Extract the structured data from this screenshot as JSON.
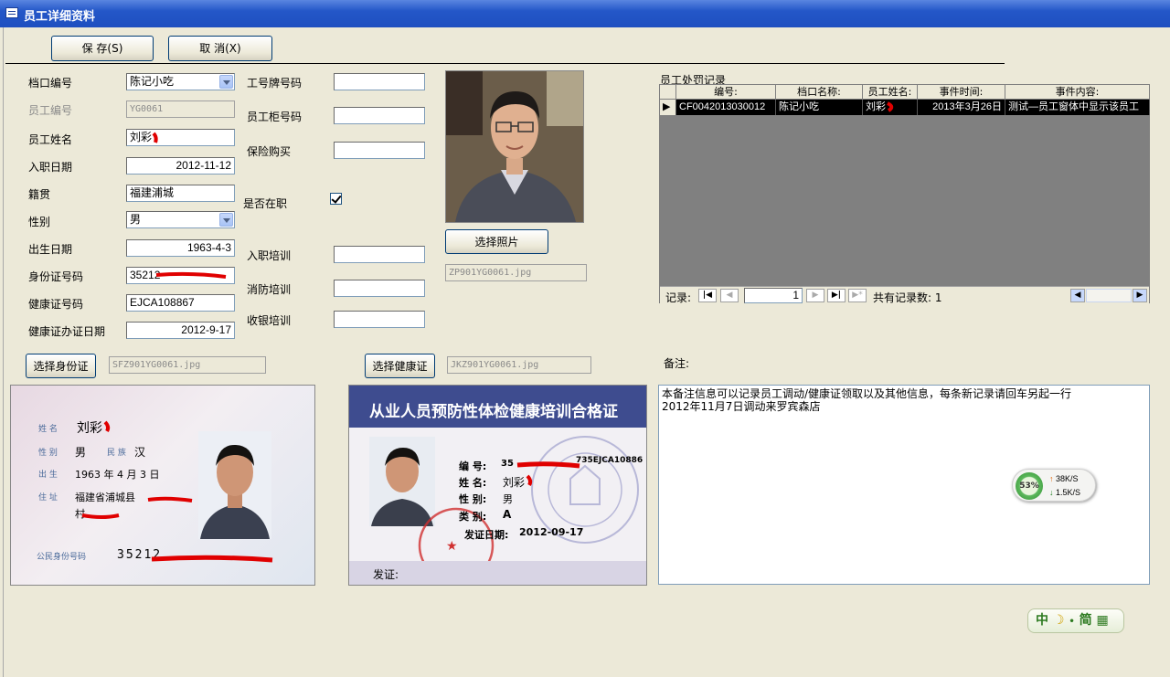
{
  "window": {
    "title": "员工详细资料"
  },
  "toolbar": {
    "save_label": "保 存(S)",
    "cancel_label": "取 消(X)"
  },
  "fields": {
    "stall_no": {
      "label": "档口编号",
      "value": "陈记小吃"
    },
    "emp_no": {
      "label": "员工编号",
      "value": "YG0061"
    },
    "emp_name": {
      "label": "员工姓名",
      "value": "刘彩"
    },
    "hire_date": {
      "label": "入职日期",
      "value": "2012-11-12"
    },
    "native": {
      "label": "籍贯",
      "value": "福建浦城"
    },
    "gender": {
      "label": "性别",
      "value": "男"
    },
    "birth": {
      "label": "出生日期",
      "value": "1963-4-3"
    },
    "id_no": {
      "label": "身份证号码",
      "value": "35212"
    },
    "health_no": {
      "label": "健康证号码",
      "value": "EJCA108867"
    },
    "health_date": {
      "label": "健康证办证日期",
      "value": "2012-9-17"
    },
    "badge_no": {
      "label": "工号牌号码",
      "value": ""
    },
    "locker_no": {
      "label": "员工柜号码",
      "value": ""
    },
    "insurance": {
      "label": "保险购买",
      "value": ""
    },
    "employed": {
      "label": "是否在职",
      "checked": true
    },
    "hire_training": {
      "label": "入职培训",
      "value": ""
    },
    "fire_training": {
      "label": "消防培训",
      "value": ""
    },
    "cashier_training": {
      "label": "收银培训",
      "value": ""
    }
  },
  "photo": {
    "button_label": "选择照片",
    "file": "ZP901YG0061.jpg"
  },
  "id_card": {
    "button_label": "选择身份证",
    "file": "SFZ901YG0061.jpg",
    "image_text": {
      "name_k": "姓 名",
      "name_v": "刘彩",
      "sex_k": "性 别",
      "sex_v": "男",
      "nation_k": "民 族",
      "nation_v": "汉",
      "birth_k": "出 生",
      "birth_v": "1963 年 4 月 3 日",
      "addr_k": "住 址",
      "addr_v": "福建省浦城县",
      "addr_v2": "村",
      "idnum_k": "公民身份号码",
      "idnum_v": "35212"
    }
  },
  "health_card": {
    "button_label": "选择健康证",
    "file": "JKZ901YG0061.jpg",
    "image_text": {
      "title": "从业人员预防性体检健康培训合格证",
      "no_k": "编 号:",
      "no_v": "35",
      "no_v2": "735EJCA10886",
      "name_k": "姓 名:",
      "name_v": "刘彩",
      "sex_k": "性 别:",
      "sex_v": "男",
      "type_k": "类 别:",
      "type_v": "A",
      "date_k": "发证日期:",
      "date_v": "2012-09-17",
      "issuer_k": "发证:"
    }
  },
  "penalty": {
    "title": "员工处罚记录",
    "columns": [
      "编号:",
      "档口名称:",
      "员工姓名:",
      "事件时间:",
      "事件内容:"
    ],
    "rows": [
      [
        "CF0042013030012",
        "陈记小吃",
        "刘彩",
        "2013年3月26日",
        "测试—员工窗体中显示该员工"
      ]
    ],
    "nav": {
      "record_label": "记录:",
      "current": "1",
      "total_label": "共有记录数: 1"
    }
  },
  "remarks": {
    "label": "备注:",
    "lines": [
      "本备注信息可以记录员工调动/健康证领取以及其他信息，每条新记录请回车另起一行",
      "2012年11月7日调动来罗宾森店"
    ]
  },
  "net_widget": {
    "percent": "53%",
    "up": "38K/S",
    "down": "1.5K/S"
  },
  "ime": {
    "label": "中",
    "mode": "简"
  },
  "colors": {
    "title_blue": "#2457c8",
    "face_bg": "#ece9d8",
    "grid_bg": "#808080",
    "redact": "#e00000",
    "stamp": "#d03030"
  }
}
